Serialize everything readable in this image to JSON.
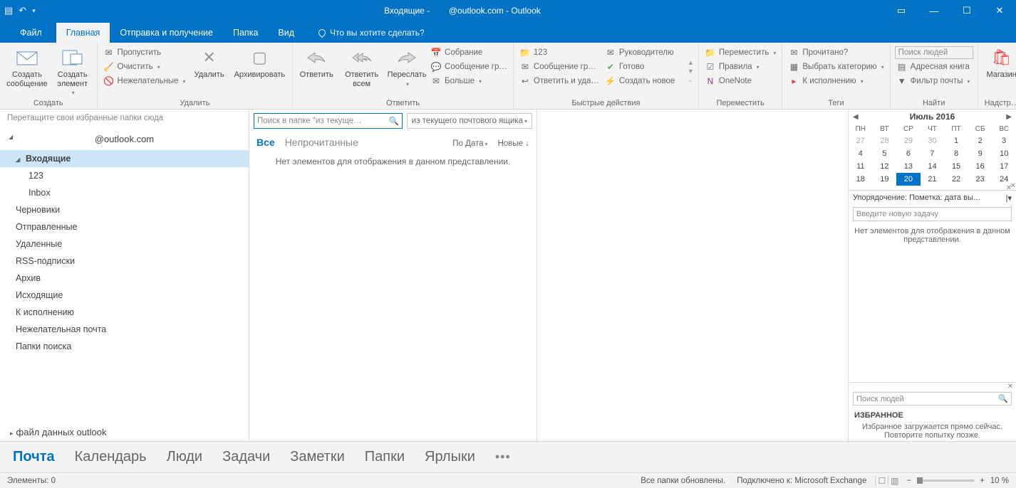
{
  "titlebar": {
    "title_left": "Входящие -",
    "title_right": "@outlook.com - Outlook"
  },
  "tabs": {
    "file": "Файл",
    "home": "Главная",
    "sendreceive": "Отправка и получение",
    "folder": "Папка",
    "view": "Вид",
    "tellme": "Что вы хотите сделать?"
  },
  "ribbon": {
    "new": {
      "mail": "Создать сообщение",
      "item": "Создать элемент",
      "label": "Создать"
    },
    "delete": {
      "ignore": "Пропустить",
      "clean": "Очистить",
      "junk": "Нежелательные",
      "delete": "Удалить",
      "archive": "Архивировать",
      "label": "Удалить"
    },
    "respond": {
      "reply": "Ответить",
      "replyall": "Ответить всем",
      "forward": "Переслать",
      "meeting": "Собрание",
      "im": "Сообщение гр…",
      "more": "Больше",
      "label": "Ответить"
    },
    "quicksteps": {
      "p1": "123",
      "p2": "Сообщение гр…",
      "p3": "Ответить и уда…",
      "p4": "Руководителю",
      "p5": "Готово",
      "p6": "Создать новое",
      "label": "Быстрые действия"
    },
    "move": {
      "move": "Переместить",
      "rules": "Правила",
      "onenote": "OneNote",
      "label": "Переместить"
    },
    "tags": {
      "read": "Прочитано?",
      "cat": "Выбрать категорию",
      "flag": "К исполнению",
      "label": "Теги"
    },
    "find": {
      "search": "Поиск людей",
      "book": "Адресная книга",
      "filter": "Фильтр почты",
      "label": "Найти"
    },
    "store": {
      "store": "Магазин",
      "label": "Надстр…"
    }
  },
  "nav": {
    "hint": "Перетащите свои избранные папки сюда",
    "account": "@outlook.com",
    "folders": [
      {
        "name": "Входящие",
        "bold": true,
        "selected": true,
        "exp": true
      },
      {
        "name": "123",
        "sub": true
      },
      {
        "name": "Inbox",
        "sub": true
      },
      {
        "name": "Черновики"
      },
      {
        "name": "Отправленные"
      },
      {
        "name": "Удаленные"
      },
      {
        "name": "RSS-подписки"
      },
      {
        "name": "Архив"
      },
      {
        "name": "Исходящие"
      },
      {
        "name": "К исполнению"
      },
      {
        "name": "Нежелательная почта"
      },
      {
        "name": "Папки поиска"
      }
    ],
    "datafile": "файл данных outlook"
  },
  "msglist": {
    "search_placeholder": "Поиск в папке \"из текуще…",
    "scope": "из текущего почтового ящика",
    "all": "Все",
    "unread": "Непрочитанные",
    "sort": "По Дата",
    "new": "Новые",
    "empty": "Нет элементов для отображения в данном представлении."
  },
  "calendar": {
    "title": "Июль 2016",
    "dow": [
      "ПН",
      "ВТ",
      "СР",
      "ЧТ",
      "ПТ",
      "СБ",
      "ВС"
    ],
    "weeks": [
      [
        {
          "d": 27,
          "o": 1
        },
        {
          "d": 28,
          "o": 1
        },
        {
          "d": 29,
          "o": 1
        },
        {
          "d": 30,
          "o": 1
        },
        {
          "d": 1
        },
        {
          "d": 2
        },
        {
          "d": 3
        }
      ],
      [
        {
          "d": 4
        },
        {
          "d": 5
        },
        {
          "d": 6
        },
        {
          "d": 7
        },
        {
          "d": 8
        },
        {
          "d": 9
        },
        {
          "d": 10
        }
      ],
      [
        {
          "d": 11
        },
        {
          "d": 12
        },
        {
          "d": 13
        },
        {
          "d": 14
        },
        {
          "d": 15
        },
        {
          "d": 16
        },
        {
          "d": 17
        }
      ],
      [
        {
          "d": 18
        },
        {
          "d": 19
        },
        {
          "d": 20,
          "t": 1
        },
        {
          "d": 21
        },
        {
          "d": 22
        },
        {
          "d": 23
        },
        {
          "d": 24
        }
      ]
    ]
  },
  "tasks": {
    "arrange": "Упорядочение: Пометка: дата вы…",
    "input_ph": "Введите новую задачу",
    "empty": "Нет элементов для отображения в данном представлении."
  },
  "people": {
    "search_ph": "Поиск людей",
    "fav_hdr": "ИЗБРАННОЕ",
    "fav_msg": "Избранное загружается прямо сейчас. Повторите попытку позже."
  },
  "navbar": {
    "mail": "Почта",
    "calendar": "Календарь",
    "people": "Люди",
    "tasks": "Задачи",
    "notes": "Заметки",
    "folders": "Папки",
    "shortcuts": "Ярлыки"
  },
  "status": {
    "items": "Элементы: 0",
    "updated": "Все папки обновлены.",
    "connected": "Подключено к: Microsoft Exchange",
    "zoom": "10 %"
  }
}
